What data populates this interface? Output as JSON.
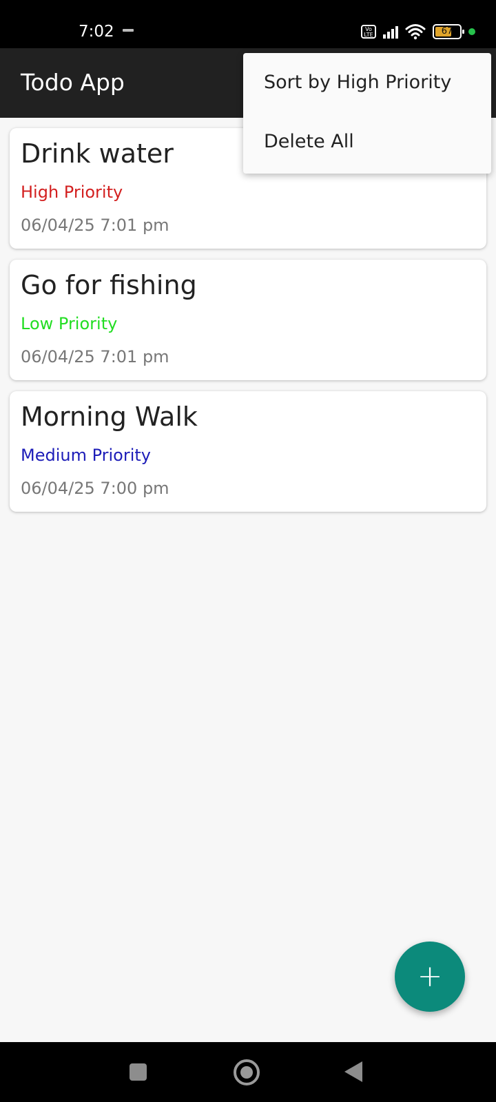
{
  "status_bar": {
    "time": "7:02",
    "volte_label": "Vo LTE",
    "battery_level": 67,
    "battery_label": "67"
  },
  "app_bar": {
    "title": "Todo App"
  },
  "menu": {
    "items": [
      {
        "label": "Sort by High Priority"
      },
      {
        "label": "Delete All"
      }
    ]
  },
  "todos": [
    {
      "title": "Drink water",
      "priority": "High Priority",
      "priority_color": "#d32020",
      "date": "06/04/25 7:01 pm"
    },
    {
      "title": "Go for fishing",
      "priority": "Low Priority",
      "priority_color": "#22dd22",
      "date": "06/04/25 7:01 pm"
    },
    {
      "title": "Morning Walk",
      "priority": "Medium Priority",
      "priority_color": "#1d1db8",
      "date": "06/04/25 7:00 pm"
    }
  ],
  "fab": {
    "icon": "plus-icon",
    "symbol": "+"
  },
  "colors": {
    "app_bar": "#212121",
    "fab": "#0c8a7b",
    "background": "#f7f7f7"
  }
}
